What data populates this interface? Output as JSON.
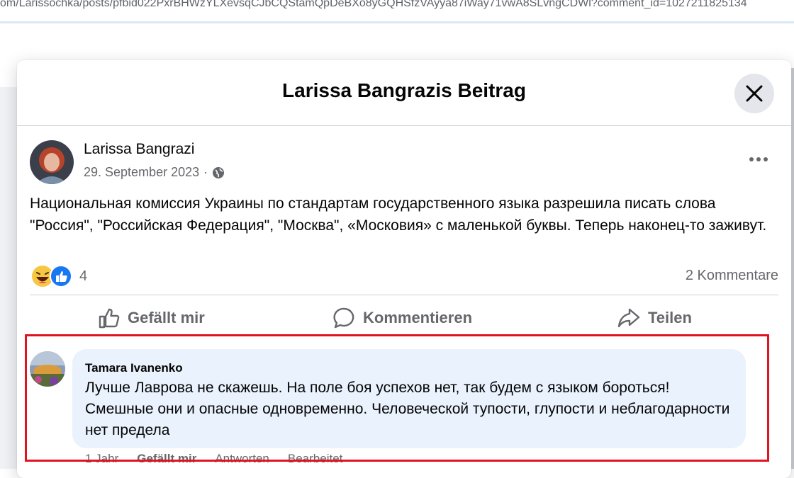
{
  "browser": {
    "url": "om/Larissochka/posts/pfbid022PxrBHWzYLXevsqCJbCQStamQpDeBXo8yGQHSfzVAyya87iWay71vwA8SLvngCDWl?comment_id=1027211825134"
  },
  "modal": {
    "title": "Larissa Bangrazis Beitrag",
    "close_icon": "close-icon"
  },
  "post": {
    "author": "Larissa Bangrazi",
    "date": "29. September 2023",
    "separator": "·",
    "visibility_icon": "globe-icon",
    "text": "Национальная комиссия Украины по стандартам государственного языка разрешила писать слова \"Россия\", \"Российская Федерация\", \"Москва\", «Московия» с маленькой буквы. Теперь наконец-то заживут.",
    "reactions": {
      "icons": [
        "laugh-reaction-icon",
        "like-reaction-icon"
      ],
      "count": "4"
    },
    "comments_count": "2 Kommentare"
  },
  "actions": {
    "like": "Gefällt mir",
    "comment": "Kommentieren",
    "share": "Teilen"
  },
  "comment": {
    "author": "Tamara Ivanenko",
    "text": "Лучше Лаврова не скажешь. На поле боя успехов нет, так будем с языком бороться! Смешные они и опасные одновременно. Человеческой тупости, глупости и неблагодарности нет предела",
    "time": "1 Jahr",
    "like": "Gefällt mir",
    "reply": "Antworten",
    "edited": "Bearbeitet"
  },
  "colors": {
    "highlight_border": "#e0141e",
    "comment_bubble": "#e9f2fd",
    "secondary_text": "#65676b",
    "like_blue": "#1877f2"
  }
}
